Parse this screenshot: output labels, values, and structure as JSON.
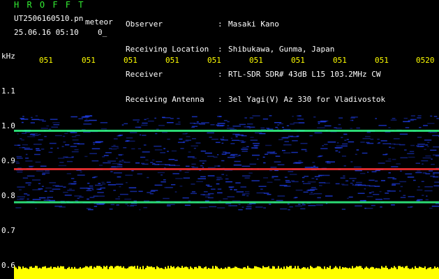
{
  "header": {
    "app_title": "H R O F F T",
    "filename": "UT2506160510.pn",
    "meteor_label": "meteor",
    "datetime": "25.06.16 05:10",
    "count": "0_"
  },
  "metadata": [
    {
      "label": "Observer",
      "value": "Masaki Kano"
    },
    {
      "label": "Receiving Location",
      "value": "Shibukawa, Gunma, Japan"
    },
    {
      "label": "Receiver",
      "value": "RTL-SDR SDR# 43dB L15 103.2MHz CW"
    },
    {
      "label": "Receiving Antenna",
      "value": "3el Yagi(V) Az 330 for Vladivostok"
    }
  ],
  "meta_colon": ":",
  "time_axis": {
    "labels": [
      "051",
      "051",
      "051",
      "051",
      "051",
      "051",
      "051",
      "051",
      "051",
      "0520"
    ]
  },
  "freq_axis": {
    "unit": "kHz",
    "labels": [
      "1.1",
      "1.0",
      "0.9",
      "0.8",
      "0.7",
      "0.6"
    ]
  },
  "colors": {
    "background": "#000000",
    "title": "#33ee33",
    "time_labels": "#ffff00",
    "amplitude_bar": "#ffff00",
    "signal_strong": "#ff3333",
    "signal_medium": "#33ff88",
    "noise": "#2244ff"
  },
  "spectrogram": {
    "freq_range_khz": [
      0.6,
      1.1
    ],
    "bands_khz": [
      {
        "freq": 0.985,
        "level": "medium"
      },
      {
        "freq": 0.875,
        "level": "strong"
      },
      {
        "freq": 0.78,
        "level": "medium"
      }
    ]
  }
}
